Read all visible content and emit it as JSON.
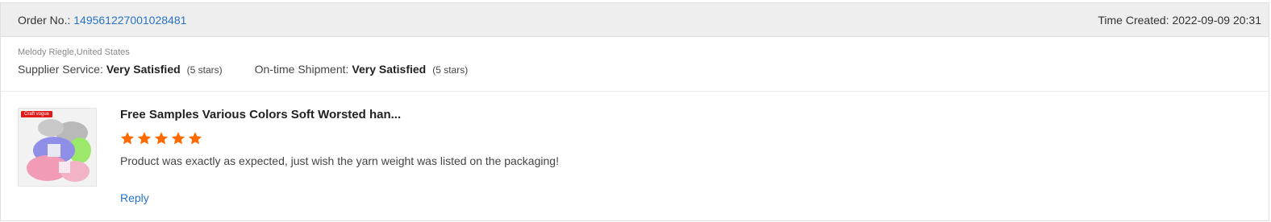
{
  "header": {
    "order_label": "Order No.:",
    "order_number": "149561227001028481",
    "time_label": "Time Created:",
    "time_value": "2022-09-09 20:31"
  },
  "buyer": {
    "name_location": "Melody Riegle,United States"
  },
  "ratings": {
    "supplier_label": "Supplier Service:",
    "supplier_value": "Very Satisfied",
    "supplier_stars": "(5 stars)",
    "shipment_label": "On-time Shipment:",
    "shipment_value": "Very Satisfied",
    "shipment_stars": "(5 stars)"
  },
  "product": {
    "image_tag": "Craft vogue",
    "title": "Free Samples Various Colors Soft Worsted han...",
    "rating": 5,
    "star_color": "#ff6a00"
  },
  "review": {
    "comment": "Product was exactly as expected, just wish the yarn weight was listed on the packaging!",
    "reply_label": "Reply"
  },
  "colors": {
    "link": "#2a73c5",
    "header_bg": "#eeeeee"
  }
}
